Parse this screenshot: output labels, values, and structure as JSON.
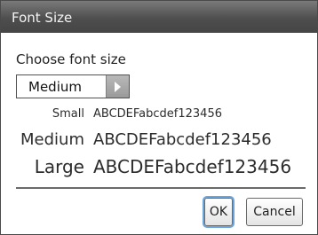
{
  "dialog": {
    "title": "Font Size",
    "prompt": "Choose font size",
    "select": {
      "value": "Medium"
    },
    "samples": [
      {
        "label": "Small",
        "text": "ABCDEFabcdef123456"
      },
      {
        "label": "Medium",
        "text": "ABCDEFabcdef123456"
      },
      {
        "label": "Large",
        "text": "ABCDEFabcdef123456"
      }
    ],
    "buttons": {
      "ok": "OK",
      "cancel": "Cancel"
    }
  },
  "icons": {
    "select_arrow": "triangle-right-icon"
  },
  "colors": {
    "titlebar": "#4e4e4e",
    "focus_ring": "#6aa5e0"
  }
}
